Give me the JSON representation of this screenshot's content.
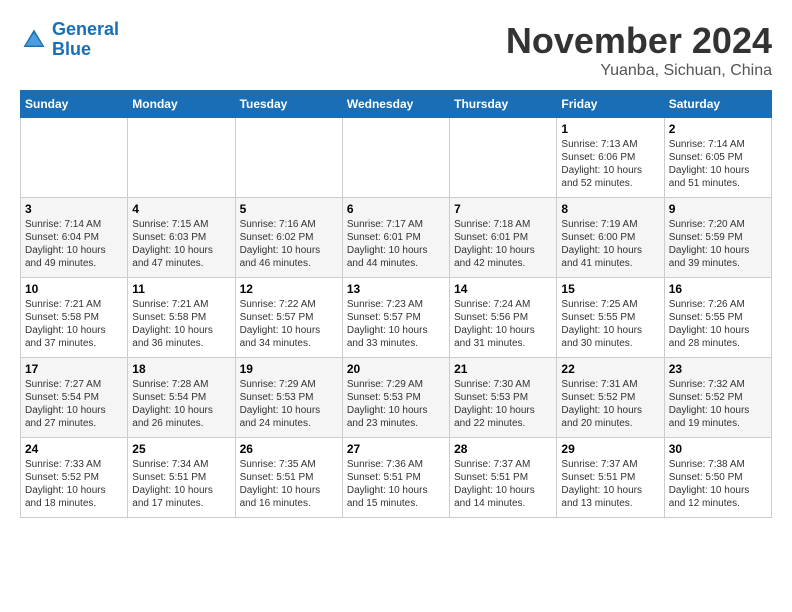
{
  "header": {
    "logo_line1": "General",
    "logo_line2": "Blue",
    "month_title": "November 2024",
    "location": "Yuanba, Sichuan, China"
  },
  "calendar": {
    "headers": [
      "Sunday",
      "Monday",
      "Tuesday",
      "Wednesday",
      "Thursday",
      "Friday",
      "Saturday"
    ],
    "weeks": [
      [
        {
          "day": "",
          "text": ""
        },
        {
          "day": "",
          "text": ""
        },
        {
          "day": "",
          "text": ""
        },
        {
          "day": "",
          "text": ""
        },
        {
          "day": "",
          "text": ""
        },
        {
          "day": "1",
          "text": "Sunrise: 7:13 AM\nSunset: 6:06 PM\nDaylight: 10 hours and 52 minutes."
        },
        {
          "day": "2",
          "text": "Sunrise: 7:14 AM\nSunset: 6:05 PM\nDaylight: 10 hours and 51 minutes."
        }
      ],
      [
        {
          "day": "3",
          "text": "Sunrise: 7:14 AM\nSunset: 6:04 PM\nDaylight: 10 hours and 49 minutes."
        },
        {
          "day": "4",
          "text": "Sunrise: 7:15 AM\nSunset: 6:03 PM\nDaylight: 10 hours and 47 minutes."
        },
        {
          "day": "5",
          "text": "Sunrise: 7:16 AM\nSunset: 6:02 PM\nDaylight: 10 hours and 46 minutes."
        },
        {
          "day": "6",
          "text": "Sunrise: 7:17 AM\nSunset: 6:01 PM\nDaylight: 10 hours and 44 minutes."
        },
        {
          "day": "7",
          "text": "Sunrise: 7:18 AM\nSunset: 6:01 PM\nDaylight: 10 hours and 42 minutes."
        },
        {
          "day": "8",
          "text": "Sunrise: 7:19 AM\nSunset: 6:00 PM\nDaylight: 10 hours and 41 minutes."
        },
        {
          "day": "9",
          "text": "Sunrise: 7:20 AM\nSunset: 5:59 PM\nDaylight: 10 hours and 39 minutes."
        }
      ],
      [
        {
          "day": "10",
          "text": "Sunrise: 7:21 AM\nSunset: 5:58 PM\nDaylight: 10 hours and 37 minutes."
        },
        {
          "day": "11",
          "text": "Sunrise: 7:21 AM\nSunset: 5:58 PM\nDaylight: 10 hours and 36 minutes."
        },
        {
          "day": "12",
          "text": "Sunrise: 7:22 AM\nSunset: 5:57 PM\nDaylight: 10 hours and 34 minutes."
        },
        {
          "day": "13",
          "text": "Sunrise: 7:23 AM\nSunset: 5:57 PM\nDaylight: 10 hours and 33 minutes."
        },
        {
          "day": "14",
          "text": "Sunrise: 7:24 AM\nSunset: 5:56 PM\nDaylight: 10 hours and 31 minutes."
        },
        {
          "day": "15",
          "text": "Sunrise: 7:25 AM\nSunset: 5:55 PM\nDaylight: 10 hours and 30 minutes."
        },
        {
          "day": "16",
          "text": "Sunrise: 7:26 AM\nSunset: 5:55 PM\nDaylight: 10 hours and 28 minutes."
        }
      ],
      [
        {
          "day": "17",
          "text": "Sunrise: 7:27 AM\nSunset: 5:54 PM\nDaylight: 10 hours and 27 minutes."
        },
        {
          "day": "18",
          "text": "Sunrise: 7:28 AM\nSunset: 5:54 PM\nDaylight: 10 hours and 26 minutes."
        },
        {
          "day": "19",
          "text": "Sunrise: 7:29 AM\nSunset: 5:53 PM\nDaylight: 10 hours and 24 minutes."
        },
        {
          "day": "20",
          "text": "Sunrise: 7:29 AM\nSunset: 5:53 PM\nDaylight: 10 hours and 23 minutes."
        },
        {
          "day": "21",
          "text": "Sunrise: 7:30 AM\nSunset: 5:53 PM\nDaylight: 10 hours and 22 minutes."
        },
        {
          "day": "22",
          "text": "Sunrise: 7:31 AM\nSunset: 5:52 PM\nDaylight: 10 hours and 20 minutes."
        },
        {
          "day": "23",
          "text": "Sunrise: 7:32 AM\nSunset: 5:52 PM\nDaylight: 10 hours and 19 minutes."
        }
      ],
      [
        {
          "day": "24",
          "text": "Sunrise: 7:33 AM\nSunset: 5:52 PM\nDaylight: 10 hours and 18 minutes."
        },
        {
          "day": "25",
          "text": "Sunrise: 7:34 AM\nSunset: 5:51 PM\nDaylight: 10 hours and 17 minutes."
        },
        {
          "day": "26",
          "text": "Sunrise: 7:35 AM\nSunset: 5:51 PM\nDaylight: 10 hours and 16 minutes."
        },
        {
          "day": "27",
          "text": "Sunrise: 7:36 AM\nSunset: 5:51 PM\nDaylight: 10 hours and 15 minutes."
        },
        {
          "day": "28",
          "text": "Sunrise: 7:37 AM\nSunset: 5:51 PM\nDaylight: 10 hours and 14 minutes."
        },
        {
          "day": "29",
          "text": "Sunrise: 7:37 AM\nSunset: 5:51 PM\nDaylight: 10 hours and 13 minutes."
        },
        {
          "day": "30",
          "text": "Sunrise: 7:38 AM\nSunset: 5:50 PM\nDaylight: 10 hours and 12 minutes."
        }
      ]
    ]
  }
}
